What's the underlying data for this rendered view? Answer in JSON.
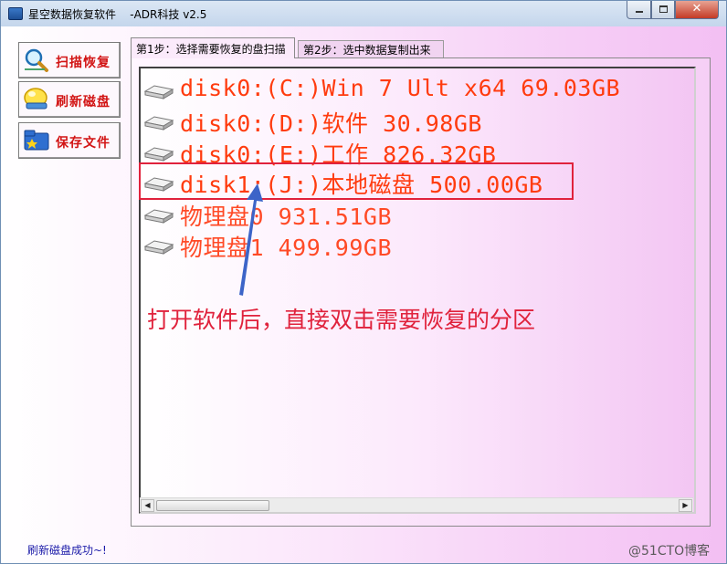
{
  "window": {
    "title": "星空数据恢复软件    -ADR科技 v2.5",
    "controls": {
      "minimize": "",
      "maximize": "",
      "close": "✕"
    }
  },
  "sidebar": {
    "buttons": [
      {
        "label": "扫描恢复",
        "icon": "magnifier-icon"
      },
      {
        "label": "刷新磁盘",
        "icon": "refresh-disk-icon"
      },
      {
        "label": "保存文件",
        "icon": "save-folder-icon"
      }
    ]
  },
  "tabs": [
    {
      "label": "第1步：选择需要恢复的盘扫描",
      "active": true
    },
    {
      "label": "第2步：选中数据复制出来",
      "active": false
    }
  ],
  "disks": [
    {
      "label": "disk0:(C:)Win 7 Ult x64 69.03GB"
    },
    {
      "label": "disk0:(D:)软件 30.98GB"
    },
    {
      "label": "disk0:(E:)工作 826.32GB"
    },
    {
      "label": "disk1:(J:)本地磁盘 500.00GB"
    },
    {
      "label": "物理盘0 931.51GB"
    },
    {
      "label": "物理盘1 499.99GB"
    }
  ],
  "annotation": {
    "text": "打开软件后，直接双击需要恢复的分区",
    "color": "#e0223c"
  },
  "scrollbar": {
    "left_arrow": "◀",
    "right_arrow": "▶"
  },
  "status": "刷新磁盘成功~!",
  "watermark": "@51CTO博客",
  "colors": {
    "disk_text": "#ff3b0e",
    "button_text": "#d21414",
    "status_text": "#1a1aa8"
  }
}
